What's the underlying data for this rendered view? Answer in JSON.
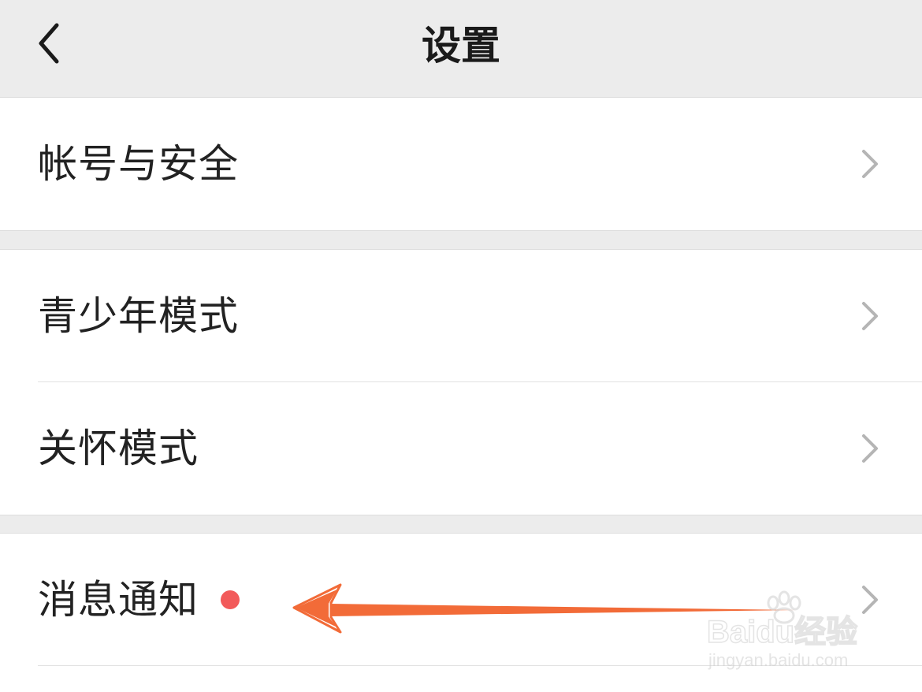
{
  "header": {
    "title": "设置"
  },
  "settings": {
    "items": [
      {
        "label": "帐号与安全"
      },
      {
        "label": "青少年模式"
      },
      {
        "label": "关怀模式"
      },
      {
        "label": "消息通知"
      }
    ]
  },
  "annotation": {
    "arrow_color": "#f26b38"
  },
  "watermark": {
    "brand": "Baidu经验",
    "url": "jingyan.baidu.com"
  },
  "colors": {
    "background": "#ececec",
    "badge": "#f25a5a",
    "chevron": "#b5b5b5"
  }
}
